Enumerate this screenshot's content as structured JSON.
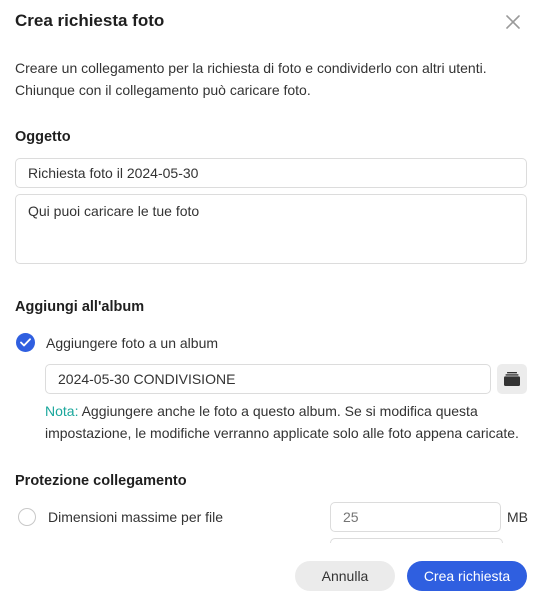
{
  "dialog": {
    "title": "Crea richiesta foto",
    "description_line1": "Creare un collegamento per la richiesta di foto e condividerlo con altri utenti.",
    "description_line2": "Chiunque con il collegamento può caricare foto."
  },
  "subject": {
    "heading": "Oggetto",
    "title_value": "Richiesta foto il 2024-05-30",
    "message_value": "Qui puoi caricare le tue foto"
  },
  "album": {
    "heading": "Aggiungi all'album",
    "checkbox_label": "Aggiungere foto a un album",
    "checked": true,
    "album_name": "2024-05-30 CONDIVISIONE",
    "note_prefix": "Nota:",
    "note_text": " Aggiungere anche le foto a questo album. Se si modifica questa impostazione, le modifiche verranno applicate solo alle foto appena caricate."
  },
  "protection": {
    "heading": "Protezione collegamento",
    "max_size_label": "Dimensioni massime per file",
    "max_size_placeholder": "25",
    "max_size_unit": "MB"
  },
  "footer": {
    "cancel_label": "Annulla",
    "create_label": "Crea richiesta"
  },
  "colors": {
    "accent": "#2f5fe0",
    "note": "#1aa79c"
  },
  "icons": {
    "close": "close-icon",
    "check": "check-icon",
    "album": "album-icon"
  }
}
